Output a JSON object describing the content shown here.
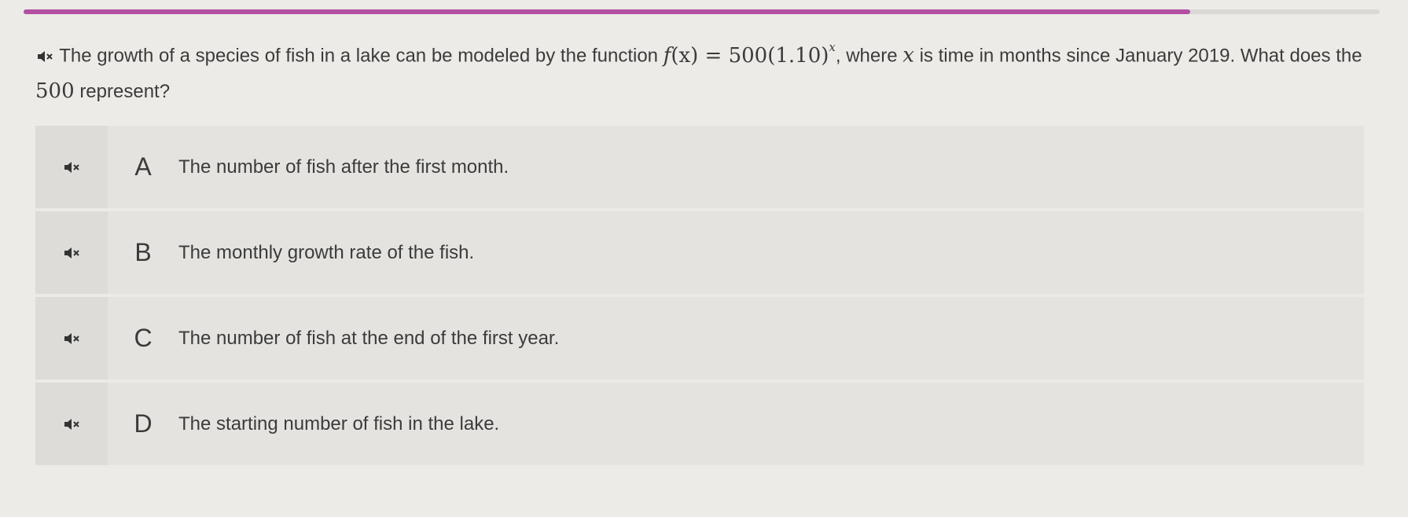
{
  "progress": {
    "fraction": 0.86,
    "color": "#b24fa3"
  },
  "question": {
    "speaker_icon": "speaker-icon",
    "text_before": "The growth of a species of fish in a lake can be modeled by the function",
    "math_f": "f",
    "math_x1": "(x)",
    "math_eq": " = 500(1.10)",
    "math_exp": "x",
    "text_after_comma": ", where",
    "math_x2": "x",
    "text_end": "is time in months since January 2019. What does the",
    "math_500": "500",
    "text_final": "represent?"
  },
  "options": [
    {
      "letter": "A",
      "text": "The number of fish after the first month."
    },
    {
      "letter": "B",
      "text": "The monthly growth rate of the fish."
    },
    {
      "letter": "C",
      "text": "The number of fish at the end of the first year."
    },
    {
      "letter": "D",
      "text": "The starting number of fish in the lake."
    }
  ]
}
